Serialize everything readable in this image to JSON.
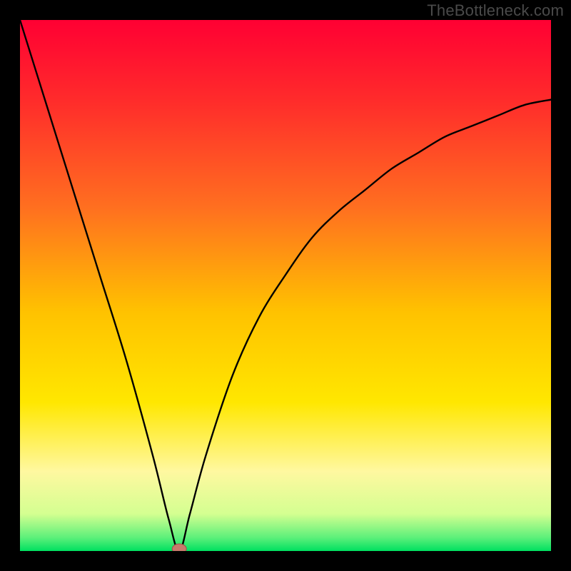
{
  "watermark": "TheBottleneck.com",
  "colors": {
    "frame": "#000000",
    "gradient_stops": [
      {
        "offset": 0.0,
        "color": "#ff0033"
      },
      {
        "offset": 0.15,
        "color": "#ff2b2b"
      },
      {
        "offset": 0.35,
        "color": "#ff6e20"
      },
      {
        "offset": 0.55,
        "color": "#ffc200"
      },
      {
        "offset": 0.72,
        "color": "#ffe700"
      },
      {
        "offset": 0.85,
        "color": "#fff8a0"
      },
      {
        "offset": 0.93,
        "color": "#d4ff91"
      },
      {
        "offset": 0.975,
        "color": "#5cf07a"
      },
      {
        "offset": 1.0,
        "color": "#00e060"
      }
    ],
    "curve": "#000000",
    "marker_fill": "#c77a6b",
    "marker_stroke": "#a05048"
  },
  "chart_data": {
    "type": "line",
    "title": "",
    "xlabel": "",
    "ylabel": "",
    "xlim": [
      0,
      100
    ],
    "ylim": [
      0,
      100
    ],
    "minimum": {
      "x": 30,
      "y": 0
    },
    "series": [
      {
        "name": "bottleneck-curve",
        "x": [
          0,
          5,
          10,
          15,
          20,
          25,
          28,
          30,
          32,
          35,
          40,
          45,
          50,
          55,
          60,
          65,
          70,
          75,
          80,
          85,
          90,
          95,
          100
        ],
        "y": [
          100,
          84,
          68,
          52,
          36,
          18,
          6,
          0,
          7,
          18,
          33,
          44,
          52,
          59,
          64,
          68,
          72,
          75,
          78,
          80,
          82,
          84,
          85
        ]
      }
    ],
    "marker": {
      "x": 30,
      "y": 0
    }
  }
}
